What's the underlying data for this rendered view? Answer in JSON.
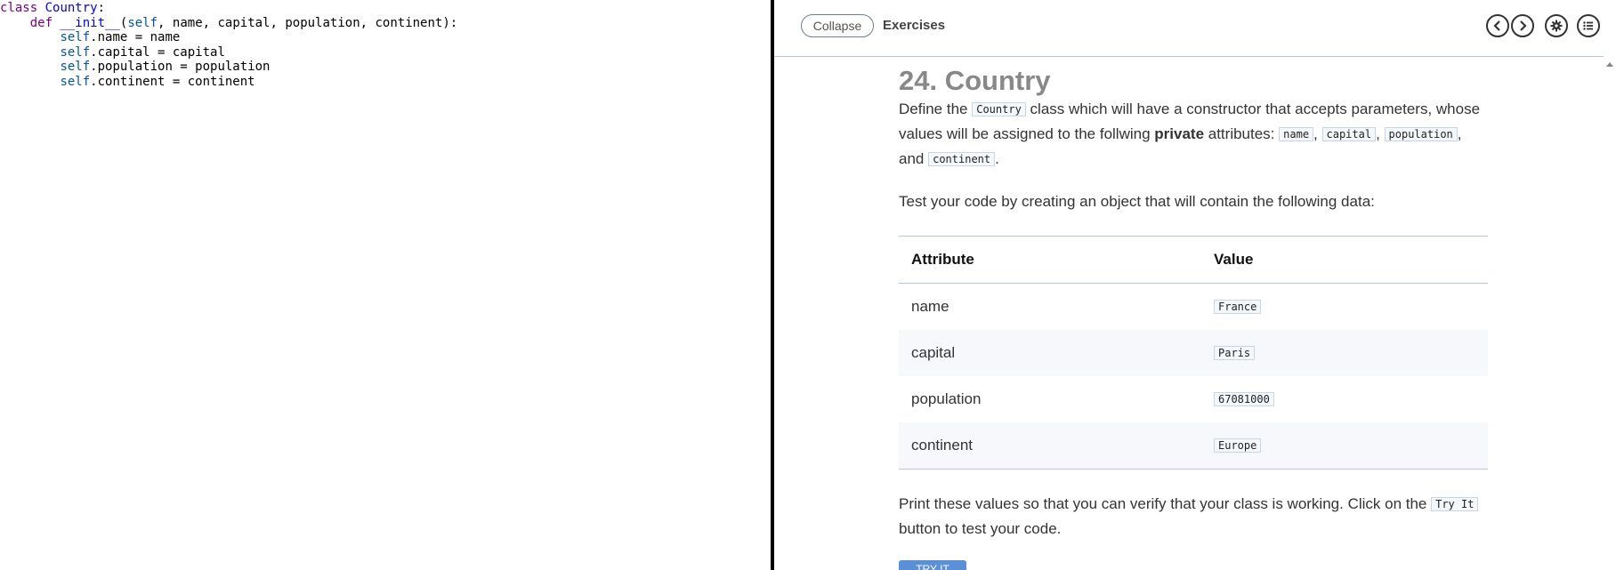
{
  "editor": {
    "lines": [
      {
        "indent": "",
        "parts": [
          {
            "t": "class",
            "c": "kw"
          },
          {
            "t": " "
          },
          {
            "t": "Country",
            "c": "def"
          },
          {
            "t": ":"
          }
        ]
      },
      {
        "indent": "    ",
        "parts": [
          {
            "t": "def",
            "c": "kw"
          },
          {
            "t": " "
          },
          {
            "t": "__init__",
            "c": "def"
          },
          {
            "t": "("
          },
          {
            "t": "self",
            "c": "var2"
          },
          {
            "t": ", name, capital, population, continent):"
          }
        ]
      },
      {
        "indent": "        ",
        "parts": [
          {
            "t": "self",
            "c": "var2"
          },
          {
            "t": ".name = name"
          }
        ]
      },
      {
        "indent": "        ",
        "parts": [
          {
            "t": "self",
            "c": "var2"
          },
          {
            "t": ".capital = capital"
          }
        ]
      },
      {
        "indent": "        ",
        "parts": [
          {
            "t": "self",
            "c": "var2"
          },
          {
            "t": ".population = population"
          }
        ]
      },
      {
        "indent": "        ",
        "parts": [
          {
            "t": "self",
            "c": "var2"
          },
          {
            "t": ".continent = continent"
          }
        ]
      }
    ]
  },
  "header": {
    "collapse_label": "Collapse",
    "title": "Exercises",
    "icons": [
      "chevron-left-icon",
      "chevron-right-icon",
      "gear-icon",
      "list-icon"
    ]
  },
  "exercise": {
    "title": "24. Country",
    "intro": {
      "p1_a": "Define the ",
      "p1_code1": "Country",
      "p1_b": " class which will have a constructor that accepts parameters, whose values will be assigned to the follwing ",
      "p1_bold": "private",
      "p1_c": " attributes: ",
      "p1_code2": "name",
      "p1_d": ", ",
      "p1_code3": "capital",
      "p1_e": ", ",
      "p1_code4": "population",
      "p1_f": ", and ",
      "p1_code5": "continent",
      "p1_g": "."
    },
    "test_text": "Test your code by creating an object that will contain the following data:",
    "table": {
      "headers": [
        "Attribute",
        "Value"
      ],
      "rows": [
        {
          "attr": "name",
          "value": "France"
        },
        {
          "attr": "capital",
          "value": "Paris"
        },
        {
          "attr": "population",
          "value": "67081000"
        },
        {
          "attr": "continent",
          "value": "Europe"
        }
      ]
    },
    "print_a": "Print these values so that you can verify that your class is working. Click on the ",
    "print_code": "Try It",
    "print_b": " button to test your code.",
    "try_button": "TRY IT"
  },
  "colors": {
    "keyword": "#770088",
    "definition": "#0000ff",
    "self": "#0055aa",
    "accent": "#5b8fd6"
  }
}
